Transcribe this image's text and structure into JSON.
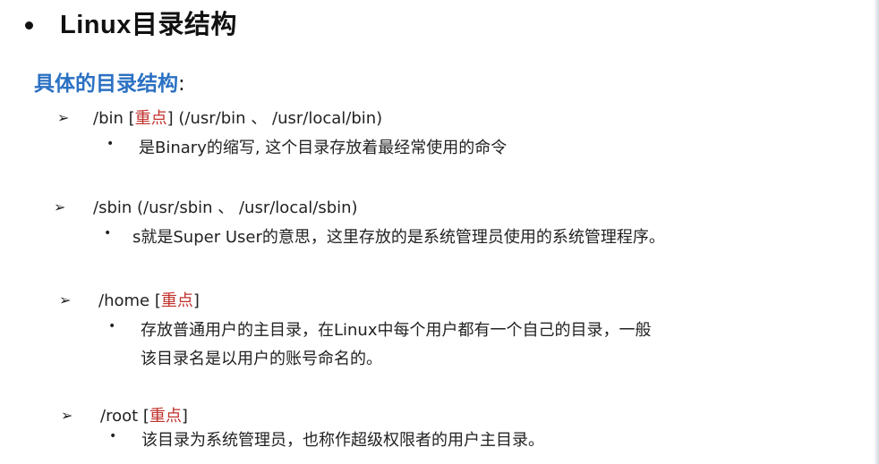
{
  "title": "Linux目录结构",
  "subtitle": "具体的目录结构",
  "subtitle_colon": ":",
  "items": [
    {
      "arrow": "➢",
      "path_before": "/bin  [",
      "key": "重点",
      "path_after": "]  (/usr/bin 、 /usr/local/bin)",
      "bullet": "•",
      "desc": [
        "是Binary的缩写, 这个目录存放着最经常使用的命令"
      ]
    },
    {
      "arrow": "➢",
      "path_before": "/sbin   (/usr/sbin 、 /usr/local/sbin)",
      "key": "",
      "path_after": "",
      "bullet": "•",
      "desc": [
        "s就是Super User的意思，这里存放的是系统管理员使用的系统管理程序。"
      ]
    },
    {
      "arrow": "➢",
      "path_before": "/home [",
      "key": "重点",
      "path_after": "]",
      "bullet": "•",
      "desc": [
        "存放普通用户的主目录，在Linux中每个用户都有一个自己的目录，一般",
        "该目录名是以用户的账号命名的。"
      ]
    },
    {
      "arrow": "➢",
      "path_before": "/root  [",
      "key": "重点",
      "path_after": "]",
      "bullet": "•",
      "desc": [
        "该目录为系统管理员，也称作超级权限者的用户主目录。"
      ]
    }
  ],
  "colors": {
    "subtitle": "#2b71c3",
    "key": "#c0312b",
    "text": "#222222"
  }
}
